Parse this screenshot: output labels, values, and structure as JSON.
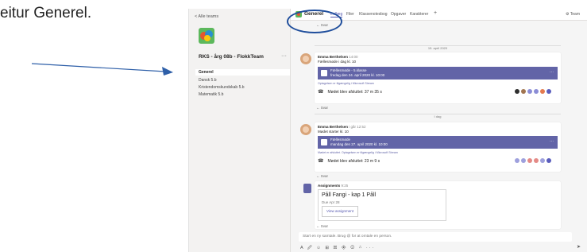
{
  "caption": "eitur Generel.",
  "sidebar": {
    "back_label": "< Alle teams",
    "team_name": "RKS - årg 08b - FlokkTeam",
    "more": "···",
    "channels": [
      "Generel",
      "Dansk 5.b",
      "Kristendomskundskab 5.b",
      "Matematik 5.b"
    ]
  },
  "topbar": {
    "channel_title": "Generel",
    "tabs": [
      "Indlæg",
      "Filer",
      "Klassenotesbog",
      "Opgaver",
      "Karakterer"
    ],
    "add": "+",
    "team_button": "⚙ Team"
  },
  "feed": {
    "reply": "← Svar",
    "date1": "15. april 2020",
    "date2": "I dag",
    "msg1": {
      "author": "Emma Berthelsen",
      "time": "14:00",
      "text": "Fællesmøde i dag kl. 10",
      "meet_title": "Fællesmøde - 5.klasse",
      "meet_time": "fredag den 24. april 2020 kl. 10:00",
      "rec_note": "Optagelsen er tilgængelig i Microsoft Stream",
      "ended": "Mødet blev afsluttet: 37 m 35 s",
      "more": "···",
      "colors": [
        "#2f2f2f",
        "#a17551",
        "#8b8dd6",
        "#8b8dd6",
        "#e47a4f",
        "#5a5dbd"
      ]
    },
    "msg2": {
      "author": "Emma Berthelsen",
      "time": "i går 12:52",
      "text": "Mødet starter kl. 10",
      "meet_title": "Fællesmøde",
      "meet_time": "mandag den 27. april 2020 kl. 10:00",
      "rec_note": "Mødet er afsluttet. Optagelsen er tilgængelig i Microsoft Stream",
      "ended": "Mødet blev afsluttet: 23 m 9 s",
      "more": "···",
      "colors": [
        "#9ea0dd",
        "#9ea0dd",
        "#e48a86",
        "#e48a86",
        "#9ea0dd",
        "#5a5dbd"
      ]
    },
    "msg3": {
      "author": "Assignments",
      "time": "9:25",
      "title": "Påll Fangi - kap 1 Påll",
      "due": "Due Apr 28",
      "view": "View assignment"
    }
  },
  "compose": {
    "placeholder": "Start en ny samtale. Brug @ for at omtale en person.",
    "format_icons": "A 🖉 ☺ ⊞ ▣ ◈ ⊙ ⇩ ···",
    "send": "➤"
  }
}
